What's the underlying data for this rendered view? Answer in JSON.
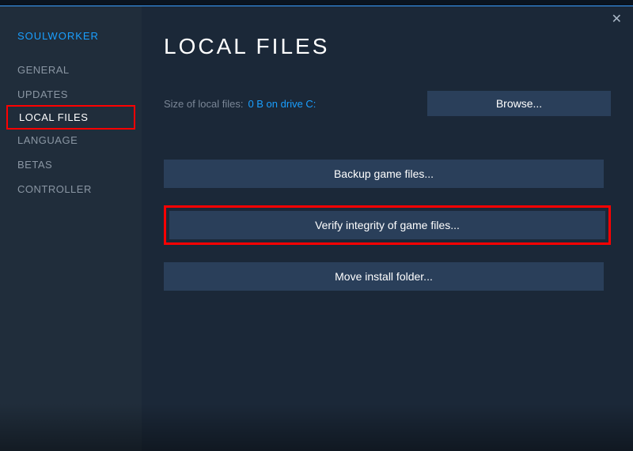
{
  "app_title": "SOULWORKER",
  "sidebar": {
    "items": [
      {
        "label": "GENERAL"
      },
      {
        "label": "UPDATES"
      },
      {
        "label": "LOCAL FILES"
      },
      {
        "label": "LANGUAGE"
      },
      {
        "label": "BETAS"
      },
      {
        "label": "CONTROLLER"
      }
    ]
  },
  "main": {
    "title": "LOCAL FILES",
    "size_label": "Size of local files:",
    "size_value": "0 B on drive C:",
    "browse_label": "Browse...",
    "backup_label": "Backup game files...",
    "verify_label": "Verify integrity of game files...",
    "move_label": "Move install folder..."
  }
}
